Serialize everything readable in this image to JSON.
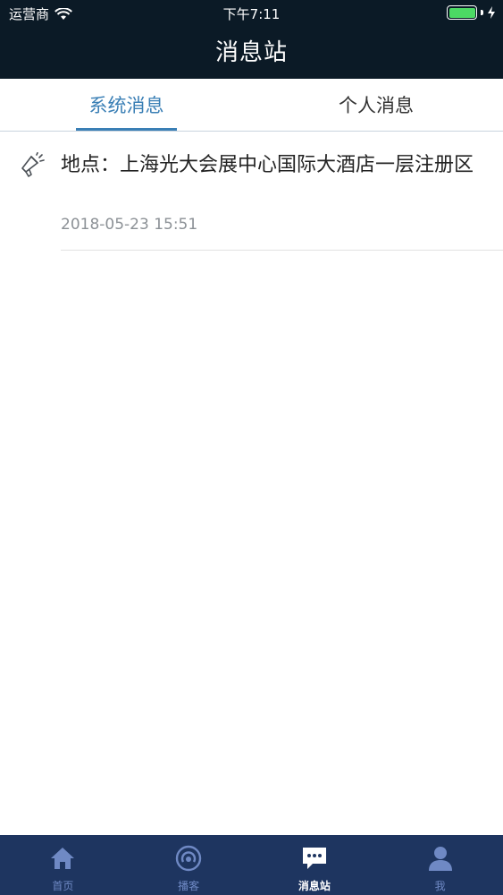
{
  "status_bar": {
    "carrier": "运营商",
    "time": "下午7:11"
  },
  "header": {
    "title": "消息站"
  },
  "tabs": [
    {
      "label": "系统消息",
      "active": true
    },
    {
      "label": "个人消息",
      "active": false
    }
  ],
  "messages": [
    {
      "icon": "megaphone-icon",
      "title": "地点：上海光大会展中心国际大酒店一层注册区",
      "time": "2018-05-23 15:51"
    }
  ],
  "bottom_nav": [
    {
      "label": "首页",
      "icon": "home-icon",
      "active": false
    },
    {
      "label": "播客",
      "icon": "broadcast-icon",
      "active": false
    },
    {
      "label": "消息站",
      "icon": "message-icon",
      "active": true
    },
    {
      "label": "我",
      "icon": "user-icon",
      "active": false
    }
  ],
  "colors": {
    "header_bg": "#0b1a26",
    "accent": "#3a7fb5",
    "bottom_nav_bg": "#1e3560",
    "battery": "#4cd964"
  }
}
